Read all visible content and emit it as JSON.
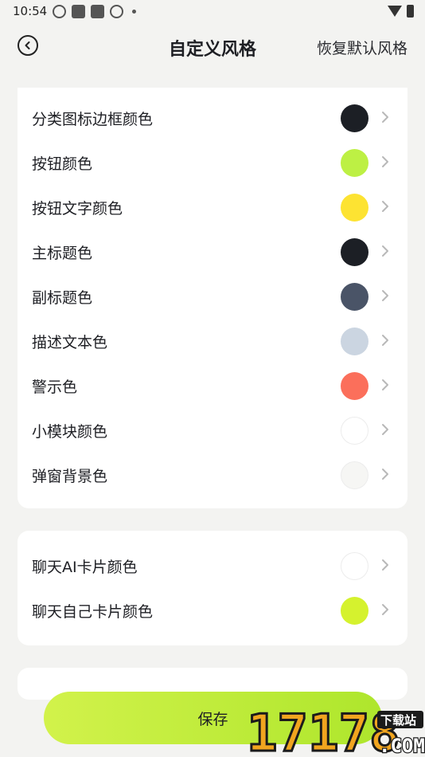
{
  "status_bar": {
    "time": "10:54",
    "icons": [
      "network-icon",
      "app-icon",
      "app-icon",
      "network-icon",
      "dot-icon"
    ],
    "right_icons": [
      "wifi-icon",
      "battery-icon"
    ]
  },
  "header": {
    "back_icon": "back-icon",
    "title": "自定义风格",
    "restore_label": "恢复默认风格"
  },
  "sections": [
    {
      "items": [
        {
          "label": "分类图标边框颜色",
          "color": "#1c1f25"
        },
        {
          "label": "按钮颜色",
          "color": "#bdf044"
        },
        {
          "label": "按钮文字颜色",
          "color": "#fde332"
        },
        {
          "label": "主标题色",
          "color": "#1c1f25"
        },
        {
          "label": "副标题色",
          "color": "#4a5467"
        },
        {
          "label": "描述文本色",
          "color": "#cbd5e1"
        },
        {
          "label": "警示色",
          "color": "#fb6f5b"
        },
        {
          "label": "小模块颜色",
          "color": "#ffffff"
        },
        {
          "label": "弹窗背景色",
          "color": "#f6f6f4"
        }
      ]
    },
    {
      "items": [
        {
          "label": "聊天AI卡片颜色",
          "color": "#ffffff"
        },
        {
          "label": "聊天自己卡片颜色",
          "color": "#d5f22e"
        }
      ]
    }
  ],
  "save_label": "保存",
  "watermark": {
    "text": "17178",
    "badge": "下载站",
    "domain": ".COM"
  }
}
